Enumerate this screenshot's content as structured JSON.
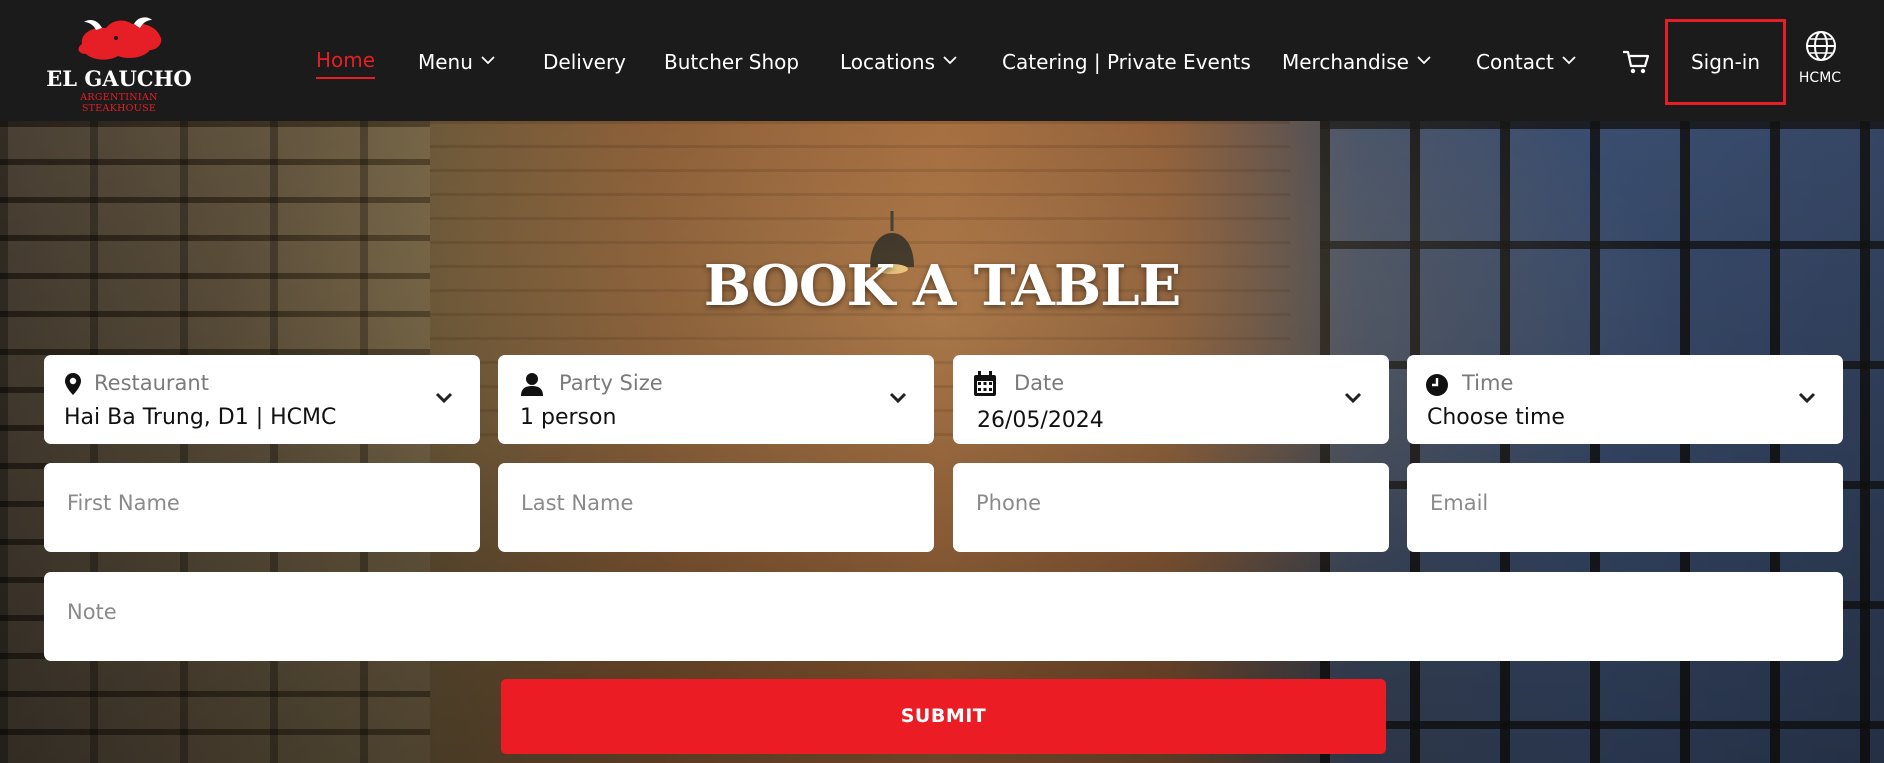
{
  "brand": {
    "name": "EL GAUCHO",
    "tagline": "ARGENTINIAN STEAKHOUSE",
    "accent_color": "#e61e25"
  },
  "nav": {
    "items": [
      {
        "label": "Home",
        "active": true,
        "dropdown": false
      },
      {
        "label": "Menu",
        "active": false,
        "dropdown": true
      },
      {
        "label": "Delivery",
        "active": false,
        "dropdown": false
      },
      {
        "label": "Butcher Shop",
        "active": false,
        "dropdown": false
      },
      {
        "label": "Locations",
        "active": false,
        "dropdown": true
      },
      {
        "label": "Catering | Private Events",
        "active": false,
        "dropdown": false
      },
      {
        "label": "Merchandise",
        "active": false,
        "dropdown": true
      },
      {
        "label": "Contact",
        "active": false,
        "dropdown": true
      }
    ],
    "cart_icon": "cart-icon",
    "signin_label": "Sign-in",
    "region_icon": "globe-icon",
    "region_label": "HCMC"
  },
  "hero": {
    "title": "BOOK A TABLE"
  },
  "booking": {
    "restaurant": {
      "label": "Restaurant",
      "value": "Hai Ba Trung, D1 | HCMC",
      "icon": "location-pin-icon"
    },
    "party_size": {
      "label": "Party Size",
      "value": "1 person",
      "icon": "person-icon"
    },
    "date": {
      "label": "Date",
      "value": "26/05/2024",
      "icon": "calendar-icon"
    },
    "time": {
      "label": "Time",
      "value": "Choose time",
      "icon": "clock-icon"
    },
    "first_name": {
      "placeholder": "First Name"
    },
    "last_name": {
      "placeholder": "Last Name"
    },
    "phone": {
      "placeholder": "Phone"
    },
    "email": {
      "placeholder": "Email"
    },
    "note": {
      "placeholder": "Note"
    },
    "submit_label": "SUBMIT",
    "submit_color": "#ec1c24"
  }
}
